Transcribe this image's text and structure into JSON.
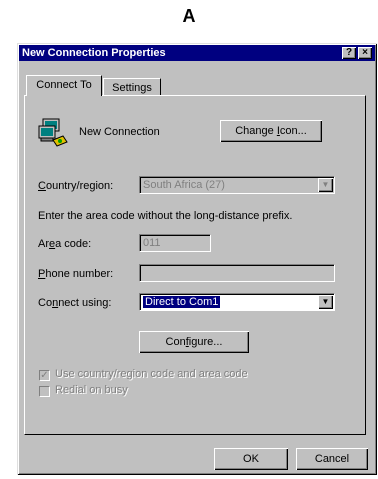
{
  "caption": "A",
  "window": {
    "title": "New Connection Properties",
    "help_btn": "?",
    "close_btn": "×"
  },
  "tabs": [
    {
      "label": "Connect To",
      "active": true
    },
    {
      "label": "Settings",
      "active": false
    }
  ],
  "connection": {
    "icon": "network-connection-icon",
    "name": "New Connection",
    "change_icon_btn": "Change Icon..."
  },
  "country_region": {
    "label": "Country/region:",
    "value": "South Africa (27)"
  },
  "hint": "Enter the area code without the long-distance prefix.",
  "area_code": {
    "label": "Area code:",
    "value": "011"
  },
  "phone_number": {
    "label": "Phone number:",
    "value": ""
  },
  "connect_using": {
    "label": "Connect using:",
    "value": "Direct to Com1"
  },
  "configure_btn": "Configure...",
  "use_country_code": {
    "label": "Use country/region code and area code",
    "checked": true
  },
  "redial_on_busy": {
    "label": "Redial on busy",
    "checked": false
  },
  "footer": {
    "ok": "OK",
    "cancel": "Cancel"
  }
}
